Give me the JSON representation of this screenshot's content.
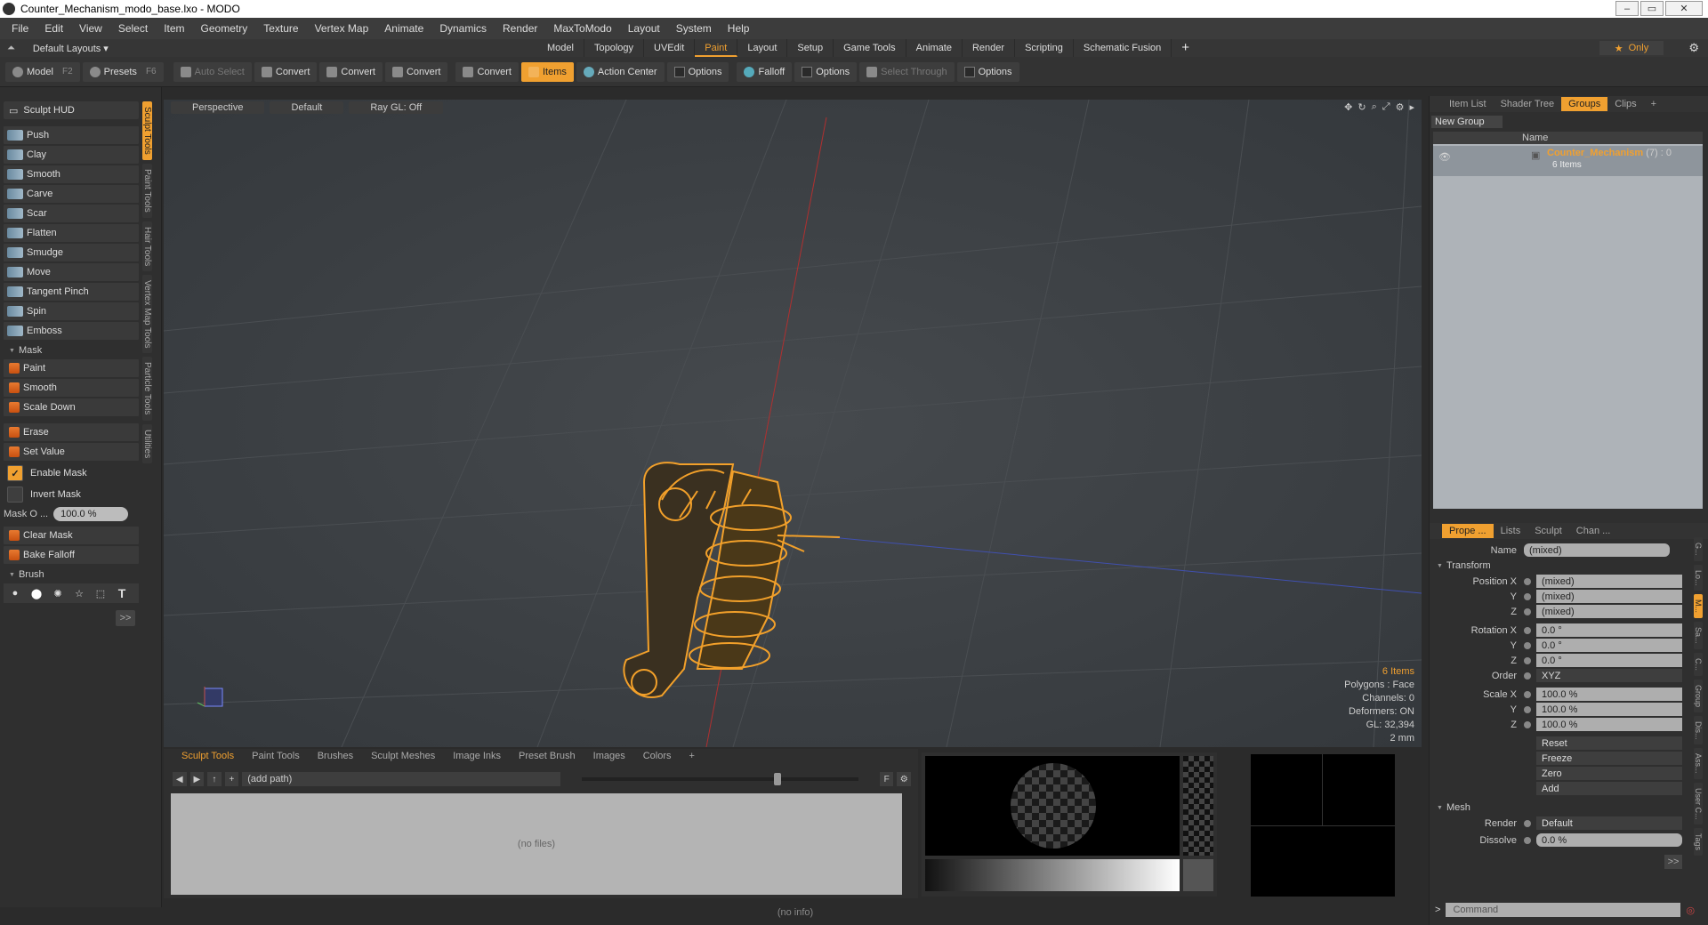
{
  "window": {
    "title": "Counter_Mechanism_modo_base.lxo - MODO"
  },
  "menu": [
    "File",
    "Edit",
    "View",
    "Select",
    "Item",
    "Geometry",
    "Texture",
    "Vertex Map",
    "Animate",
    "Dynamics",
    "Render",
    "MaxToModo",
    "Layout",
    "System",
    "Help"
  ],
  "layout_bar": {
    "layouts_label": "Default Layouts ▾",
    "tabs": [
      "Model",
      "Topology",
      "UVEdit",
      "Paint",
      "Layout",
      "Setup",
      "Game Tools",
      "Animate",
      "Render",
      "Scripting",
      "Schematic Fusion"
    ],
    "active_tab": "Paint",
    "only_label": "Only"
  },
  "toolbar": {
    "model": "Model",
    "model_key": "F2",
    "presets": "Presets",
    "presets_key": "F6",
    "auto_select": "Auto Select",
    "convert1": "Convert",
    "convert2": "Convert",
    "convert3": "Convert",
    "convert4": "Convert",
    "items": "Items",
    "action_center": "Action Center",
    "options1": "Options",
    "falloff": "Falloff",
    "options2": "Options",
    "select_through": "Select Through",
    "options3": "Options"
  },
  "left_panel": {
    "hud": "Sculpt HUD",
    "tools": [
      "Push",
      "Clay",
      "Smooth",
      "Carve",
      "Scar",
      "Flatten",
      "Smudge",
      "Move",
      "Tangent Pinch",
      "Spin",
      "Emboss"
    ],
    "mask_header": "Mask",
    "mask_tools": [
      "Paint",
      "Smooth",
      "Scale Down"
    ],
    "erase_tools": [
      "Erase",
      "Set Value"
    ],
    "enable_mask": "Enable Mask",
    "invert_mask": "Invert Mask",
    "mask_opacity_label": "Mask O ...",
    "mask_opacity_value": "100.0 %",
    "clear_mask": "Clear Mask",
    "bake_falloff": "Bake Falloff",
    "brush_header": "Brush",
    "more": ">>",
    "vtabs": [
      "Sculpt Tools",
      "Paint Tools",
      "Hair Tools",
      "Vertex Map Tools",
      "Particle Tools",
      "Utilities"
    ]
  },
  "viewport": {
    "view": "Perspective",
    "shading": "Default",
    "raygl": "Ray GL: Off",
    "info": {
      "items": "6 Items",
      "polygons": "Polygons : Face",
      "channels": "Channels: 0",
      "deformers": "Deformers: ON",
      "gl": "GL: 32,394",
      "unit": "2 mm"
    }
  },
  "browser": {
    "tabs": [
      "Sculpt Tools",
      "Paint Tools",
      "Brushes",
      "Sculpt Meshes",
      "Image Inks",
      "Preset Brush",
      "Images",
      "Colors"
    ],
    "path": "(add path)",
    "empty": "(no files)"
  },
  "status": "(no info)",
  "right_panel": {
    "tabs": [
      "Item List",
      "Shader Tree",
      "Groups",
      "Clips"
    ],
    "active_tab": "Groups",
    "new_group": "New Group",
    "col_name": "Name",
    "group_name": "Counter_Mechanism",
    "group_count": "(7) : 0",
    "group_items": "6 Items",
    "prop_tabs": [
      "Prope ...",
      "Lists",
      "Sculpt",
      "Chan ..."
    ],
    "name_label": "Name",
    "name_value": "(mixed)",
    "transform": "Transform",
    "position_x_label": "Position X",
    "position_x": "(mixed)",
    "position_y_label": "Y",
    "position_y": "(mixed)",
    "position_z_label": "Z",
    "position_z": "(mixed)",
    "rotation_x_label": "Rotation X",
    "rotation_x": "0.0 °",
    "rotation_y_label": "Y",
    "rotation_y": "0.0 °",
    "rotation_z_label": "Z",
    "rotation_z": "0.0 °",
    "order_label": "Order",
    "order": "XYZ",
    "scale_x_label": "Scale X",
    "scale_x": "100.0 %",
    "scale_y_label": "Y",
    "scale_y": "100.0 %",
    "scale_z_label": "Z",
    "scale_z": "100.0 %",
    "reset": "Reset",
    "freeze": "Freeze",
    "zero": "Zero",
    "add": "Add",
    "mesh": "Mesh",
    "render_label": "Render",
    "render": "Default",
    "dissolve_label": "Dissolve",
    "dissolve": "0.0 %",
    "more": ">>",
    "command_placeholder": "Command",
    "rvtabs": [
      "G...",
      "Lo...",
      "M...",
      "Sa...",
      "C...",
      "Group",
      "Dis...",
      "Ass...",
      "User C...",
      "Tags"
    ]
  },
  "colors": {
    "accent": "#f0a030",
    "background": "#2b2b2b"
  }
}
